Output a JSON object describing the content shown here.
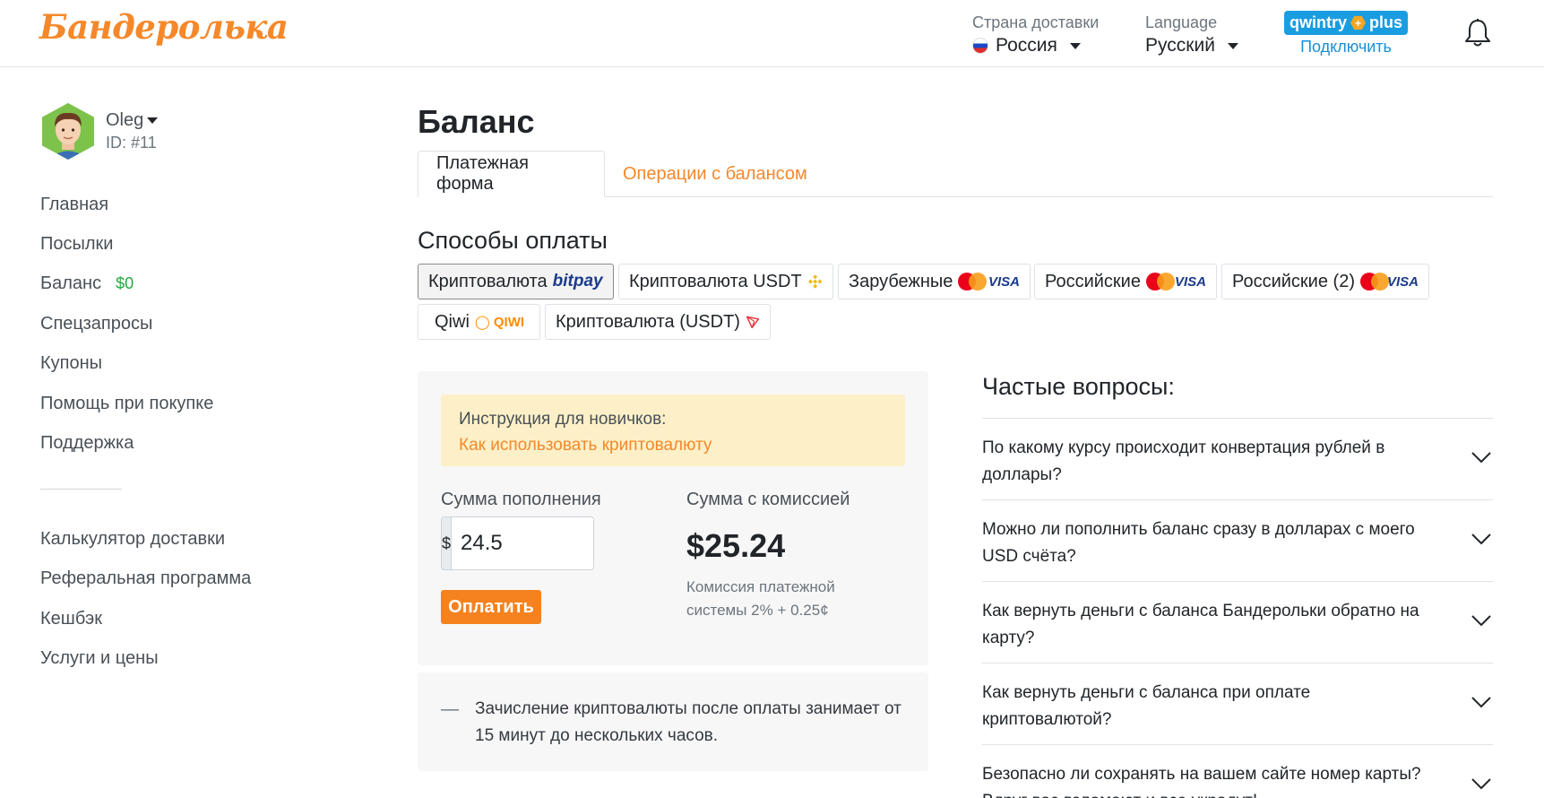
{
  "header": {
    "logo": "Бандеролька",
    "country_label": "Страна доставки",
    "country_value": "Россия",
    "language_label": "Language",
    "language_value": "Русский",
    "plus_badge_left": "qwintry",
    "plus_badge_right": "plus",
    "plus_connect": "Подключить"
  },
  "user": {
    "name": "Oleg",
    "id": "ID: #11"
  },
  "sidebar": {
    "items": [
      {
        "label": "Главная"
      },
      {
        "label": "Посылки"
      },
      {
        "label": "Баланс",
        "badge": "$0"
      },
      {
        "label": "Спецзапросы"
      },
      {
        "label": "Купоны"
      },
      {
        "label": "Помощь при покупке"
      },
      {
        "label": "Поддержка"
      }
    ],
    "secondary": [
      {
        "label": "Калькулятор доставки"
      },
      {
        "label": "Реферальная программа"
      },
      {
        "label": "Кешбэк"
      },
      {
        "label": "Услуги и цены"
      }
    ]
  },
  "main": {
    "title": "Баланс",
    "tabs": [
      {
        "label": "Платежная форма",
        "active": true
      },
      {
        "label": "Операции с балансом",
        "active": false
      }
    ],
    "methods_title": "Способы оплаты",
    "methods": [
      {
        "label": "Криптовалюта",
        "logo": "bitpay",
        "selected": true
      },
      {
        "label": "Криптовалюта USDT",
        "icon": "binance-icon"
      },
      {
        "label": "Зарубежные",
        "logo_cards": "VISA"
      },
      {
        "label": "Российские",
        "logo_cards": "VISA"
      },
      {
        "label": "Российские (2)",
        "logo_cards": "VISA"
      },
      {
        "label": "Qiwi",
        "logo": "QIWI"
      },
      {
        "label": "Криптовалюта (USDT)",
        "icon": "tron-icon"
      }
    ],
    "instruction_label": "Инструкция для новичков:",
    "instruction_link": "Как использовать криптовалюту",
    "amount_label": "Сумма пополнения",
    "amount_currency": "$",
    "amount_value": "24.5",
    "total_label": "Сумма с комиссией",
    "total_value": "$25.24",
    "commission_note": "Комиссия платежной системы 2% + 0.25¢",
    "submit_label": "Оплатить",
    "note_dash": "—",
    "note_text": "Зачисление криптовалюты после оплаты занимает от 15 минут до нескольких часов."
  },
  "faq": {
    "title": "Частые вопросы:",
    "items": [
      {
        "q": "По какому курсу происходит конвертация рублей в доллары?"
      },
      {
        "q": "Можно ли пополнить баланс сразу в долларах с моего USD счёта?"
      },
      {
        "q": "Как вернуть деньги с баланса Бандерольки обратно на карту?"
      },
      {
        "q": "Как вернуть деньги с баланса при оплате криптовалютой?"
      },
      {
        "q": "Безопасно ли сохранять на вашем сайте номер карты? Вдруг вас взломают и все украдут!"
      }
    ]
  },
  "colors": {
    "brand": "#f5882a",
    "link_blue": "#1a8fd6",
    "success": "#28a745",
    "alert_bg": "#fdf0c8"
  }
}
